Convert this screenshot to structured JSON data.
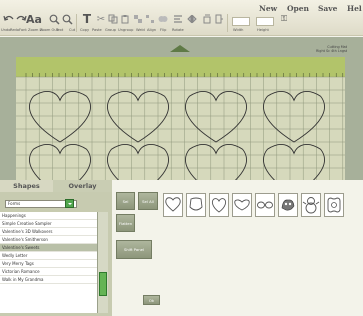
{
  "menu": {
    "new": "New",
    "open": "Open",
    "save": "Save",
    "help": "Hel"
  },
  "toolbar": {
    "labels": [
      "Undo",
      "Redo",
      "Font",
      "Zoom In",
      "Zoom Out",
      "Text",
      "Cut",
      "Copy",
      "Paste",
      "Group",
      "Ungroup",
      "Weld",
      "Align",
      "Flip",
      "Rotate",
      "Width",
      "Height"
    ]
  },
  "canvas": {
    "cartridge_name": "Cutting Mat",
    "cartridge_sub": "Right Sc 4th Lngst",
    "mat_color": "#b2c46a",
    "bg_color": "#a7b09a"
  },
  "tabs": {
    "shapes": "Shapes",
    "overlay": "Overlay"
  },
  "cartridge_select": {
    "value": "Forms"
  },
  "cartridge_list": [
    "Happenings",
    "Simple Creative Sampler",
    "Valentine's 3D Walkovers",
    "Valentine's Smitherson",
    "Valentine's Sweets",
    "Wedly Letter",
    "Very Merry Tags",
    "Victorian Romance",
    "Walk in My Grandma"
  ],
  "selected_index": 4,
  "buttons": {
    "a": "Sel",
    "b": "Sel All",
    "c": "Flatten",
    "fill": "Shift Panel",
    "ok": "Ok"
  },
  "shape_icons": [
    "heart-icon",
    "pentagon-icon",
    "oval-heart-icon",
    "wide-heart-icon",
    "glasses-icon",
    "bird-icon",
    "snowman-icon",
    "frame-icon"
  ],
  "accent": "#51a64e"
}
